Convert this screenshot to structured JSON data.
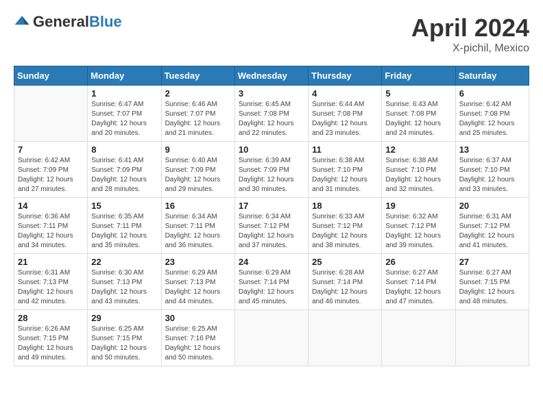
{
  "header": {
    "logo_general": "General",
    "logo_blue": "Blue",
    "title": "April 2024",
    "subtitle": "X-pichil, Mexico"
  },
  "calendar": {
    "days_of_week": [
      "Sunday",
      "Monday",
      "Tuesday",
      "Wednesday",
      "Thursday",
      "Friday",
      "Saturday"
    ],
    "weeks": [
      [
        {
          "day": "",
          "info": ""
        },
        {
          "day": "1",
          "info": "Sunrise: 6:47 AM\nSunset: 7:07 PM\nDaylight: 12 hours\nand 20 minutes."
        },
        {
          "day": "2",
          "info": "Sunrise: 6:46 AM\nSunset: 7:07 PM\nDaylight: 12 hours\nand 21 minutes."
        },
        {
          "day": "3",
          "info": "Sunrise: 6:45 AM\nSunset: 7:08 PM\nDaylight: 12 hours\nand 22 minutes."
        },
        {
          "day": "4",
          "info": "Sunrise: 6:44 AM\nSunset: 7:08 PM\nDaylight: 12 hours\nand 23 minutes."
        },
        {
          "day": "5",
          "info": "Sunrise: 6:43 AM\nSunset: 7:08 PM\nDaylight: 12 hours\nand 24 minutes."
        },
        {
          "day": "6",
          "info": "Sunrise: 6:42 AM\nSunset: 7:08 PM\nDaylight: 12 hours\nand 25 minutes."
        }
      ],
      [
        {
          "day": "7",
          "info": "Sunrise: 6:42 AM\nSunset: 7:09 PM\nDaylight: 12 hours\nand 27 minutes."
        },
        {
          "day": "8",
          "info": "Sunrise: 6:41 AM\nSunset: 7:09 PM\nDaylight: 12 hours\nand 28 minutes."
        },
        {
          "day": "9",
          "info": "Sunrise: 6:40 AM\nSunset: 7:09 PM\nDaylight: 12 hours\nand 29 minutes."
        },
        {
          "day": "10",
          "info": "Sunrise: 6:39 AM\nSunset: 7:09 PM\nDaylight: 12 hours\nand 30 minutes."
        },
        {
          "day": "11",
          "info": "Sunrise: 6:38 AM\nSunset: 7:10 PM\nDaylight: 12 hours\nand 31 minutes."
        },
        {
          "day": "12",
          "info": "Sunrise: 6:38 AM\nSunset: 7:10 PM\nDaylight: 12 hours\nand 32 minutes."
        },
        {
          "day": "13",
          "info": "Sunrise: 6:37 AM\nSunset: 7:10 PM\nDaylight: 12 hours\nand 33 minutes."
        }
      ],
      [
        {
          "day": "14",
          "info": "Sunrise: 6:36 AM\nSunset: 7:11 PM\nDaylight: 12 hours\nand 34 minutes."
        },
        {
          "day": "15",
          "info": "Sunrise: 6:35 AM\nSunset: 7:11 PM\nDaylight: 12 hours\nand 35 minutes."
        },
        {
          "day": "16",
          "info": "Sunrise: 6:34 AM\nSunset: 7:11 PM\nDaylight: 12 hours\nand 36 minutes."
        },
        {
          "day": "17",
          "info": "Sunrise: 6:34 AM\nSunset: 7:12 PM\nDaylight: 12 hours\nand 37 minutes."
        },
        {
          "day": "18",
          "info": "Sunrise: 6:33 AM\nSunset: 7:12 PM\nDaylight: 12 hours\nand 38 minutes."
        },
        {
          "day": "19",
          "info": "Sunrise: 6:32 AM\nSunset: 7:12 PM\nDaylight: 12 hours\nand 39 minutes."
        },
        {
          "day": "20",
          "info": "Sunrise: 6:31 AM\nSunset: 7:12 PM\nDaylight: 12 hours\nand 41 minutes."
        }
      ],
      [
        {
          "day": "21",
          "info": "Sunrise: 6:31 AM\nSunset: 7:13 PM\nDaylight: 12 hours\nand 42 minutes."
        },
        {
          "day": "22",
          "info": "Sunrise: 6:30 AM\nSunset: 7:13 PM\nDaylight: 12 hours\nand 43 minutes."
        },
        {
          "day": "23",
          "info": "Sunrise: 6:29 AM\nSunset: 7:13 PM\nDaylight: 12 hours\nand 44 minutes."
        },
        {
          "day": "24",
          "info": "Sunrise: 6:29 AM\nSunset: 7:14 PM\nDaylight: 12 hours\nand 45 minutes."
        },
        {
          "day": "25",
          "info": "Sunrise: 6:28 AM\nSunset: 7:14 PM\nDaylight: 12 hours\nand 46 minutes."
        },
        {
          "day": "26",
          "info": "Sunrise: 6:27 AM\nSunset: 7:14 PM\nDaylight: 12 hours\nand 47 minutes."
        },
        {
          "day": "27",
          "info": "Sunrise: 6:27 AM\nSunset: 7:15 PM\nDaylight: 12 hours\nand 48 minutes."
        }
      ],
      [
        {
          "day": "28",
          "info": "Sunrise: 6:26 AM\nSunset: 7:15 PM\nDaylight: 12 hours\nand 49 minutes."
        },
        {
          "day": "29",
          "info": "Sunrise: 6:25 AM\nSunset: 7:15 PM\nDaylight: 12 hours\nand 50 minutes."
        },
        {
          "day": "30",
          "info": "Sunrise: 6:25 AM\nSunset: 7:16 PM\nDaylight: 12 hours\nand 50 minutes."
        },
        {
          "day": "",
          "info": ""
        },
        {
          "day": "",
          "info": ""
        },
        {
          "day": "",
          "info": ""
        },
        {
          "day": "",
          "info": ""
        }
      ]
    ]
  }
}
